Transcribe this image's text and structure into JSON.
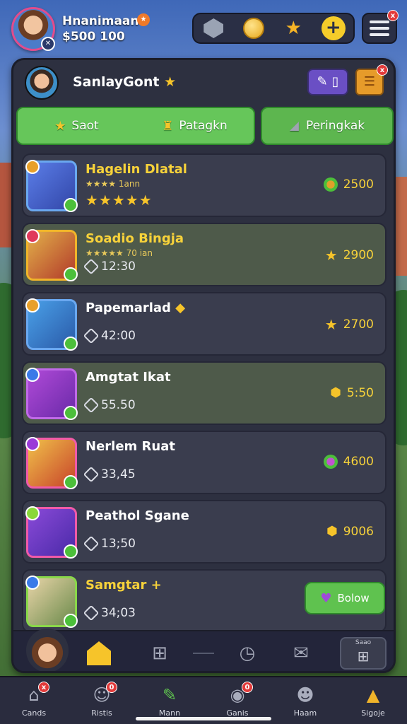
{
  "player": {
    "name": "Hnanimaan",
    "coins": "$500 100"
  },
  "resources": {
    "icons": [
      "gem-icon",
      "coin-icon",
      "star-icon",
      "plus-icon"
    ]
  },
  "panel": {
    "title": "SanlayGont",
    "tabs": [
      {
        "label": "Saot",
        "icon": "star-icon"
      },
      {
        "label": "Patagkn",
        "icon": "trophy-icon"
      },
      {
        "label": "Peringkak",
        "icon": "megaphone-icon"
      }
    ]
  },
  "rows": [
    {
      "title": "Hagelin Dlatal",
      "sub": "★★★★ 1ann",
      "stars": "★★★★★",
      "score": "2500",
      "score_color": "#e0a02a"
    },
    {
      "title": "Soadio Bingja",
      "sub": "★★★★★ 70 ian",
      "time": "12:30",
      "score": "2900",
      "score_color": "#f6c42a"
    },
    {
      "title": "Papemarlad",
      "time": "42:00",
      "score": "2700",
      "score_color": "#f6c42a"
    },
    {
      "title": "Amgtat Ikat",
      "time": "55.50",
      "score": "5:50",
      "score_color": "#f6c42a"
    },
    {
      "title": "Nerlem Ruat",
      "time": "33,45",
      "score": "4600",
      "score_color": "#c254d0"
    },
    {
      "title": "Peathol Sgane",
      "time": "13;50",
      "score": "9006",
      "score_color": "#f6c42a"
    },
    {
      "title": "Samgtar +",
      "time": "34;03",
      "button": "Bolow"
    }
  ],
  "panel_toolbar": {
    "box_label": "Saao"
  },
  "bottom_nav": [
    {
      "label": "Cands",
      "icon": "house-icon",
      "badge": "x"
    },
    {
      "label": "Ristis",
      "icon": "chat-icon",
      "badge": "0"
    },
    {
      "label": "Mann",
      "icon": "pencil-icon",
      "badge": ""
    },
    {
      "label": "Ganis",
      "icon": "controller-icon",
      "badge": "0"
    },
    {
      "label": "Haam",
      "icon": "robot-icon",
      "badge": ""
    },
    {
      "label": "Sigoje",
      "icon": "lamp-icon",
      "badge": ""
    }
  ]
}
